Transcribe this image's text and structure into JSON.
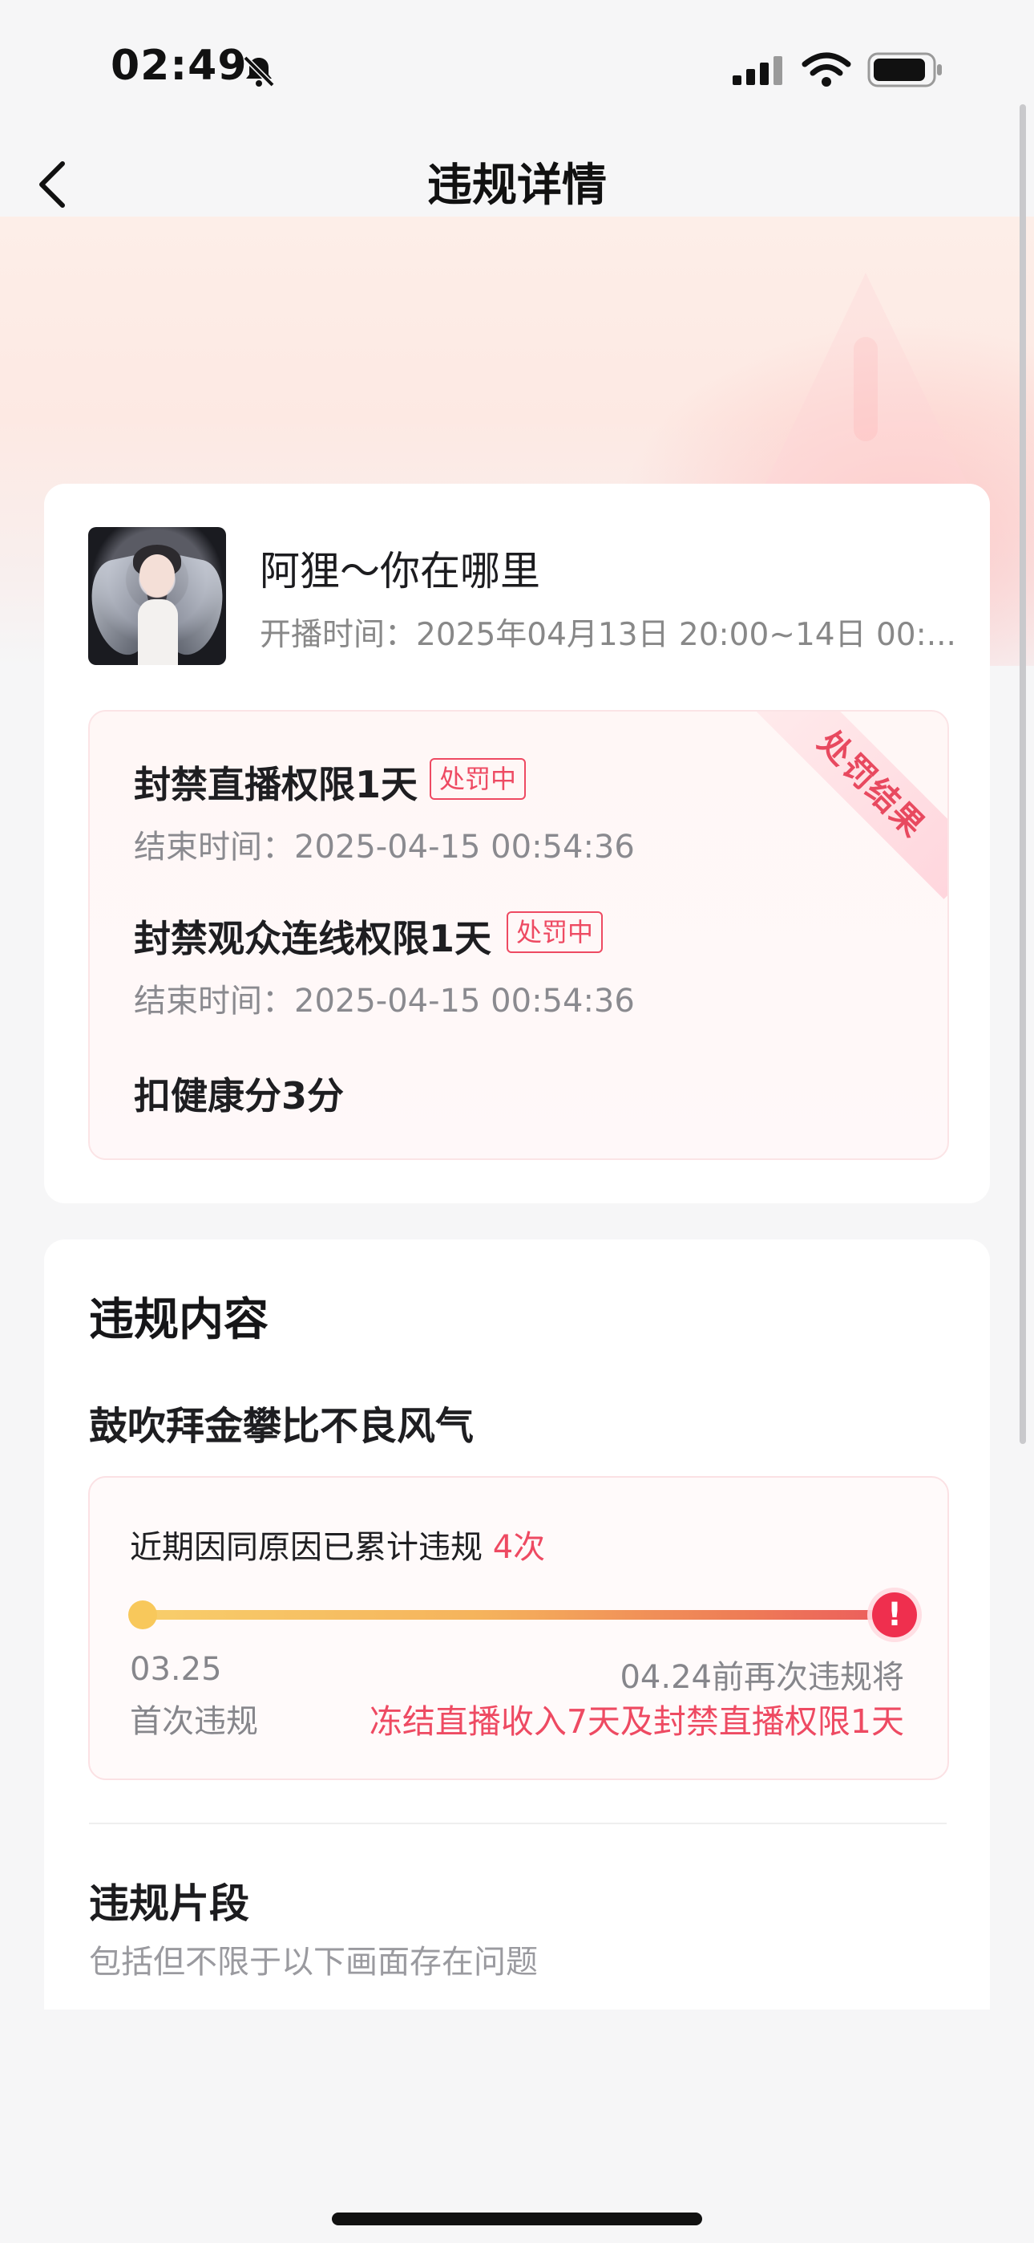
{
  "status_bar": {
    "time": "02:49"
  },
  "nav": {
    "title": "违规详情"
  },
  "stream": {
    "anchor_name": "阿狸～你在哪里",
    "live_time": "开播时间：2025年04月13日 20:00~14日 00:..."
  },
  "penalty": {
    "ribbon": "处罚结果",
    "items": [
      {
        "title": "封禁直播权限1天",
        "tag": "处罚中",
        "end_time": "结束时间：2025-04-15 00:54:36"
      },
      {
        "title": "封禁观众连线权限1天",
        "tag": "处罚中",
        "end_time": "结束时间：2025-04-15 00:54:36"
      }
    ],
    "score_deduction": "扣健康分3分"
  },
  "violation": {
    "section_title": "违规内容",
    "reason": "鼓吹拜金攀比不良风气",
    "count_prefix": "近期因同原因已累计违规",
    "count_value": "4次",
    "first_date": "03.25",
    "first_label": "首次违规",
    "deadline": "04.24前再次违规将",
    "consequence": "冻结直播收入7天及封禁直播权限1天",
    "end_marker": "!"
  },
  "clips": {
    "title": "违规片段",
    "subtitle": "包括但不限于以下画面存在问题"
  },
  "colors": {
    "accent": "#ee4a62",
    "progress_start": "#f8ce6b",
    "progress_end": "#ec5b5d"
  }
}
